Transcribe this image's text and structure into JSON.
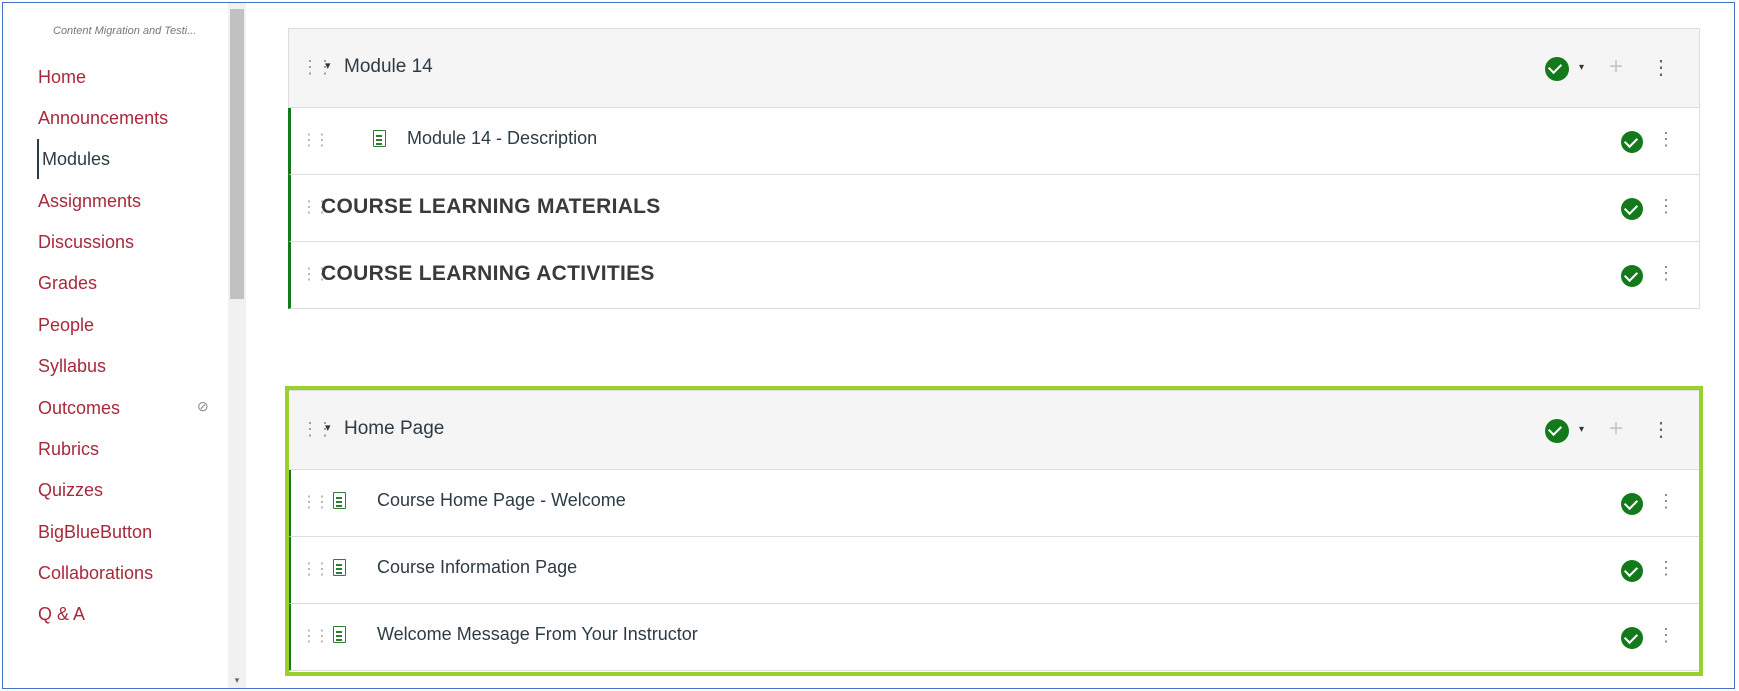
{
  "course_name": "Content Migration and Testi...",
  "nav": [
    {
      "label": "Home"
    },
    {
      "label": "Announcements"
    },
    {
      "label": "Modules"
    },
    {
      "label": "Assignments"
    },
    {
      "label": "Discussions"
    },
    {
      "label": "Grades"
    },
    {
      "label": "People"
    },
    {
      "label": "Syllabus"
    },
    {
      "label": "Outcomes"
    },
    {
      "label": "Rubrics"
    },
    {
      "label": "Quizzes"
    },
    {
      "label": "BigBlueButton"
    },
    {
      "label": "Collaborations"
    },
    {
      "label": "Q & A"
    }
  ],
  "active_nav": "Modules",
  "hidden_icon": "eye-slash-icon",
  "modules": [
    {
      "title": "Module 14",
      "items": [
        {
          "label": "Module 14 - Description",
          "type": "page",
          "indent": 2
        },
        {
          "label": "COURSE LEARNING MATERIALS",
          "type": "subheader"
        },
        {
          "label": "COURSE LEARNING ACTIVITIES",
          "type": "subheader"
        }
      ]
    },
    {
      "title": "Home Page",
      "items": [
        {
          "label": "Course Home Page - Welcome",
          "type": "page"
        },
        {
          "label": "Course Information Page",
          "type": "page"
        },
        {
          "label": "Welcome Message From Your Instructor",
          "type": "page"
        }
      ]
    }
  ],
  "colors": {
    "nav_link": "#a8293b",
    "published_green": "#127a1b",
    "highlight": "#9ad02d",
    "frame_border": "#4472c4"
  },
  "glyphs": {
    "drag": "⋮⋮",
    "caret": "▾",
    "plus": "+",
    "kebab": "⋮",
    "eye_slash": "⊘",
    "scroll_down": "▾"
  }
}
